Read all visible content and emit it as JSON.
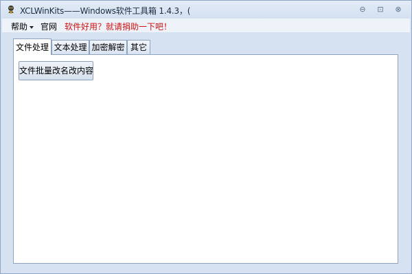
{
  "window": {
    "title": "XCLWinKits——Windows软件工具箱   1.4.3，(",
    "controls": {
      "minimize_glyph": "⊖",
      "restore_glyph": "⊡",
      "close_glyph": "⊗"
    }
  },
  "menubar": {
    "help_label": "帮助",
    "website_label": "官网",
    "promo_text": "软件好用？就请捐助一下吧！",
    "promo_color": "#d01010"
  },
  "tabs": [
    {
      "label": "文件处理",
      "active": true
    },
    {
      "label": "文本处理",
      "active": false
    },
    {
      "label": "加密解密",
      "active": false
    },
    {
      "label": "其它",
      "active": false
    }
  ],
  "panel": {
    "batch_rename_button": "文件批量改名改内容"
  },
  "icons": {
    "app": "app-logo-icon",
    "dropdown": "chevron-down-icon"
  }
}
